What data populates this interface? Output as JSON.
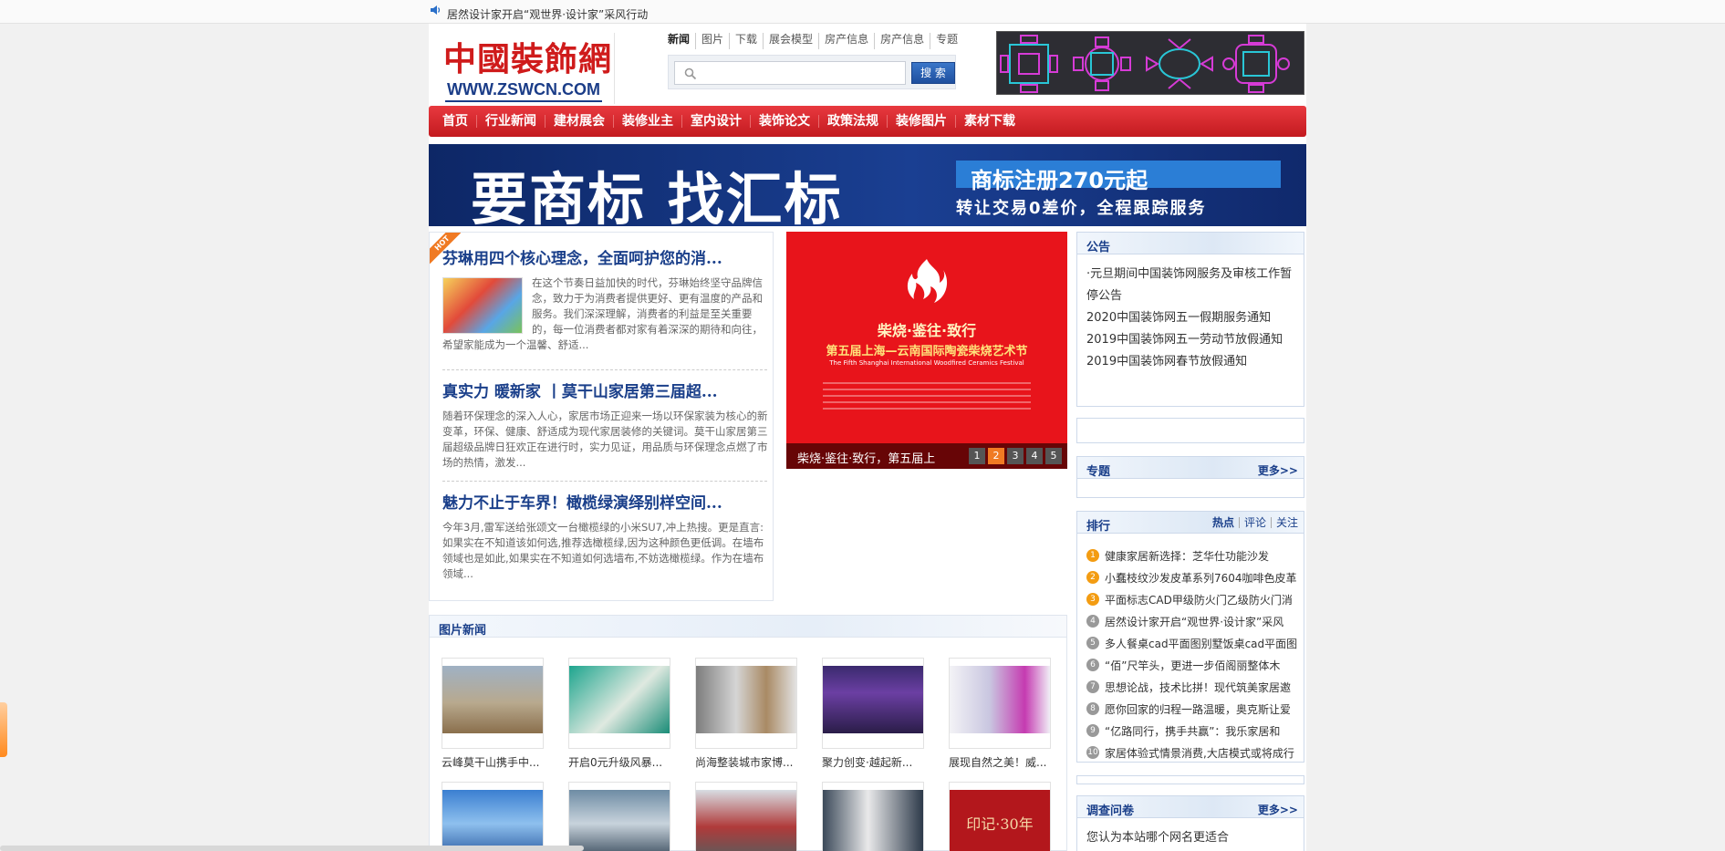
{
  "ticker": {
    "text": "居然设计家开启“观世界·设计家”采风行动"
  },
  "logo": {
    "cn": "中國裝飾網",
    "en": "WWW.ZSWCN.COM"
  },
  "search": {
    "tabs": [
      "新闻",
      "图片",
      "下载",
      "展会模型",
      "房产信息",
      "房产信息",
      "专题"
    ],
    "placeholder": "",
    "value": "",
    "button_label": "搜 索"
  },
  "nav": {
    "items": [
      "首页",
      "行业新闻",
      "建材展会",
      "装修业主",
      "室内设计",
      "装饰论文",
      "政策法规",
      "装修图片",
      "素材下载"
    ]
  },
  "banner": {
    "slogan": "要商标 找汇标",
    "tag": "商标注册270元起",
    "sub": "转让交易0差价，全程跟踪服务"
  },
  "hot_label": "HOT",
  "articles": [
    {
      "title": "芬琳用四个核心理念，全面呵护您的消...",
      "text": "在这个节奏日益加快的时代，芬琳始终坚守品牌信念，致力于为消费者提供更好、更有温度的产品和服务。我们深深理解，消费者的利益是至关重要的，每一位消费者都对家有着深深的期待和向往，希望家能成为一个温馨、舒适..."
    },
    {
      "title": "真实力 暖新家 丨莫干山家居第三届超...",
      "text": "随着环保理念的深入人心，家居市场正迎来一场以环保家装为核心的新变革，环保、健康、舒适成为现代家居装修的关键词。莫干山家居第三届超级品牌日狂欢正在进行时，实力见证，用品质与环保理念点燃了市场的热情，激发..."
    },
    {
      "title": "魅力不止于车界！橄榄绿演绎别样空间...",
      "text": "今年3月,雷军送给张颂文一台橄榄绿的小米SU7,冲上热搜。更是直言:如果实在不知道该如何选,推荐选橄榄绿,因为这种颜色更低调。在墙布领域也是如此,如果实在不知道如何选墙布,不妨选橄榄绿。作为在墙布领域..."
    }
  ],
  "slideshow": {
    "title1": "柴烧·鉴往·致行",
    "title2": "第五届上海—云南国际陶瓷柴烧艺术节",
    "title3": "The Fifth Shanghai International Woodfired Ceramics Festival",
    "caption": "柴烧·鉴往·致行，第五届上",
    "pages": [
      "1",
      "2",
      "3",
      "4",
      "5"
    ],
    "active_page": 2
  },
  "image_news": {
    "title": "图片新闻",
    "row1": [
      "云峰莫干山携手中...",
      "开启0元升级风暴...",
      "尚海整装城市家博...",
      "聚力创变·越起新...",
      "展现自然之美！威..."
    ],
    "row2_badge": "印记·30年"
  },
  "notice": {
    "title": "公告",
    "items": [
      "·元旦期间中国装饰网服务及审核工作暂停公告",
      "2020中国装饰网五一假期服务通知",
      "2019中国装饰网五一劳动节放假通知",
      "2019中国装饰网春节放假通知"
    ]
  },
  "special": {
    "title": "专题",
    "more": "更多>>"
  },
  "ranking": {
    "title": "排行",
    "tabs": [
      "热点",
      "评论",
      "关注"
    ],
    "items": [
      {
        "num": "1",
        "text": "健康家居新选择：芝华仕功能沙发"
      },
      {
        "num": "2",
        "text": "小蠢枝纹沙发皮革系列7604咖啡色皮革"
      },
      {
        "num": "3",
        "text": "平面标志CAD甲级防火门乙级防火门消"
      },
      {
        "num": "4",
        "text": "居然设计家开启“观世界·设计家”采风"
      },
      {
        "num": "5",
        "text": "多人餐桌cad平面图别墅饭桌cad平面图"
      },
      {
        "num": "6",
        "text": "“佰”尺竿头，更进一步佰阁丽整体木"
      },
      {
        "num": "7",
        "text": "思想论战，技术比拼！现代筑美家居邀"
      },
      {
        "num": "8",
        "text": "愿你回家的归程一路温暖，奥克斯让爱"
      },
      {
        "num": "9",
        "text": "“亿路同行，携手共赢”：我乐家居和"
      },
      {
        "num": "10",
        "text": "家居体验式情景消费,大店模式或将成行"
      }
    ],
    "colors": {
      "top": "#f39c12",
      "rest": "#999999"
    }
  },
  "survey": {
    "title": "调查问卷",
    "more": "更多>>",
    "question": "您认为本站哪个网名更适合"
  },
  "colors": {
    "nav_red": "#d2252a",
    "brand_blue": "#1a3f8a",
    "logo_red": "#cf1b1b"
  }
}
